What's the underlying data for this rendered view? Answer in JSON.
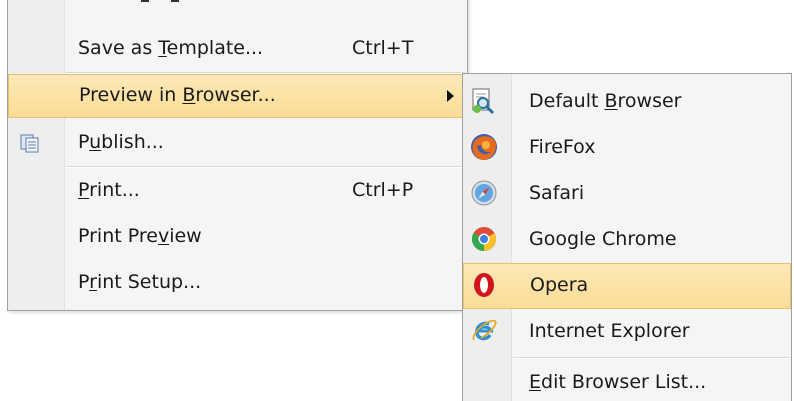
{
  "menu": {
    "partial_top_item": "…",
    "items": [
      {
        "pre": "Save as ",
        "acc": "T",
        "post": "emplate...",
        "shortcut": "Ctrl+T"
      },
      {
        "pre": "Preview in ",
        "acc": "B",
        "post": "rowser...",
        "shortcut": ""
      },
      {
        "pre": "P",
        "acc": "u",
        "post": "blish...",
        "shortcut": "",
        "icon": "publish-icon"
      },
      {
        "pre": "",
        "acc": "P",
        "post": "rint...",
        "shortcut": "Ctrl+P"
      },
      {
        "pre": "Print Pre",
        "acc": "v",
        "post": "iew",
        "shortcut": ""
      },
      {
        "pre": "P",
        "acc": "r",
        "post": "int Setup...",
        "shortcut": ""
      }
    ],
    "highlighted_item": "Preview in Browser...",
    "accent_color": "#fbdc95"
  },
  "submenu": {
    "items": [
      {
        "pre": "Default ",
        "acc": "B",
        "post": "rowser",
        "icon": "default-browser-icon"
      },
      {
        "pre": "FireFox",
        "acc": "",
        "post": "",
        "icon": "firefox-icon"
      },
      {
        "pre": "Safari",
        "acc": "",
        "post": "",
        "icon": "safari-icon"
      },
      {
        "pre": "Google Chrome",
        "acc": "",
        "post": "",
        "icon": "chrome-icon"
      },
      {
        "pre": "Opera",
        "acc": "",
        "post": "",
        "icon": "opera-icon"
      },
      {
        "pre": "Internet Explorer",
        "acc": "",
        "post": "",
        "icon": "internet-explorer-icon"
      },
      {
        "pre": "",
        "acc": "E",
        "post": "dit Browser List...",
        "icon": ""
      }
    ],
    "highlighted_item": "Opera"
  }
}
